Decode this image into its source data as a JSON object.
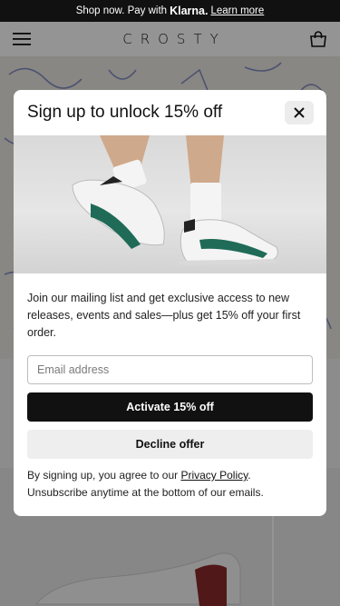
{
  "announcement": {
    "prefix": "Shop now. Pay with",
    "brand": "Klarna.",
    "link": "Learn more"
  },
  "header": {
    "logo": "CROSTY",
    "menu_icon": "menu-icon",
    "bag_icon": "shopping-bag-icon"
  },
  "modal": {
    "title": "Sign up to unlock 15% off",
    "close_icon": "close-icon",
    "description": "Join our mailing list and get exclusive access to new releases, events and sales—plus get 15% off your first order.",
    "email_placeholder": "Email address",
    "email_value": "",
    "activate_label": "Activate 15% off",
    "decline_label": "Decline offer",
    "legal_prefix": "By signing up, you agree to our ",
    "legal_link": "Privacy Policy",
    "legal_suffix": ". Unsubscribe anytime at the bottom of our emails."
  },
  "colors": {
    "announcement_bg": "#111111",
    "primary_button": "#111111",
    "secondary_button": "#eeeeee",
    "sneaker_accent": "#1f6b57"
  }
}
